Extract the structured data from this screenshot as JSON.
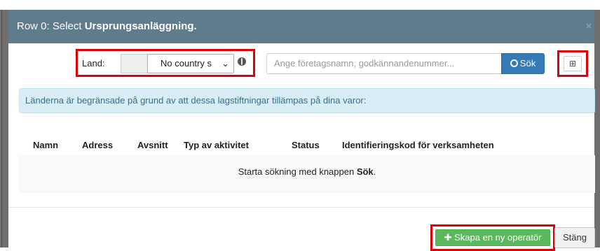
{
  "dialog": {
    "title_prefix": "Row 0: Select ",
    "title_bold": "Ursprungsanläggning.",
    "close_glyph": "×"
  },
  "filter": {
    "land_label": "Land:",
    "country_select_value": "No country s",
    "globe_icon": "globe-icon",
    "search_placeholder": "Ange företagsnamn, godkännandenummer...",
    "search_button_label": "Sök",
    "expand_glyph": "⊞"
  },
  "info_message": "Länderna är begränsade på grund av att dessa lagstiftningar tillämpas på dina varor:",
  "table": {
    "columns": [
      "Namn",
      "Adress",
      "Avsnitt",
      "Typ av aktivitet",
      "Status",
      "Identifieringskod för verksamheten"
    ],
    "empty_prefix": "Starta sökning med knappen ",
    "empty_bold": "Sök",
    "empty_suffix": "."
  },
  "footer": {
    "create_button_label": "Skapa en ny operatör",
    "close_button_label": "Stäng"
  },
  "colors": {
    "header_bg": "#5f7b8c",
    "primary": "#337ab7",
    "success": "#5cb85c",
    "info_bg": "#d9edf7",
    "highlight": "#e00000"
  }
}
